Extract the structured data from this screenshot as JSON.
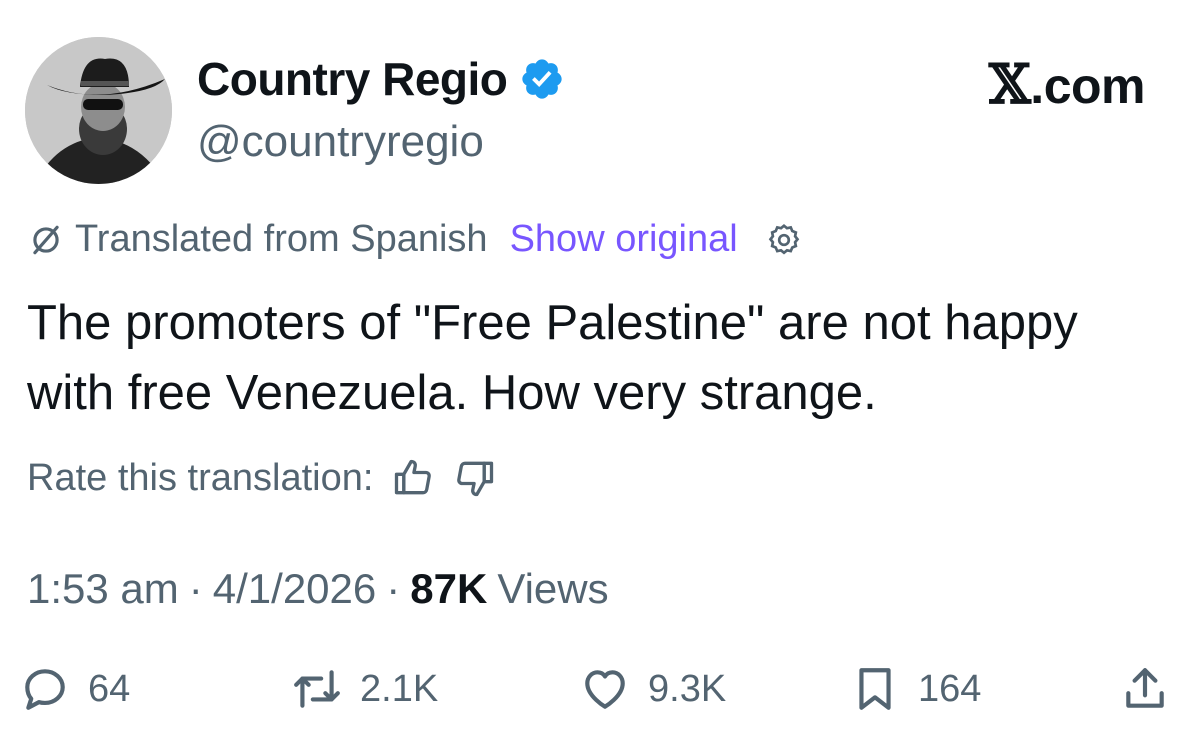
{
  "author": {
    "display_name": "Country Regio",
    "handle": "@countryregio",
    "verified": true,
    "verified_color": "#1d9bf0"
  },
  "site": {
    "x_glyph": "𝕏",
    "domain": ".com"
  },
  "translation": {
    "label": "Translated from Spanish",
    "show_original": "Show original",
    "link_color": "#7856ff",
    "rate_label": "Rate this translation:"
  },
  "tweet": {
    "text": "The promoters of \"Free Palestine\" are not happy with free Venezuela. How very strange."
  },
  "meta": {
    "time": "1:53 am",
    "separator1": "·",
    "date": "4/1/2026",
    "separator2": "·",
    "views_count": "87K",
    "views_label": "Views"
  },
  "actions": {
    "replies": "64",
    "reposts": "2.1K",
    "likes": "9.3K",
    "bookmarks": "164"
  },
  "icons": {
    "verified": "verified-badge-icon",
    "translate": "globe-slash-icon",
    "settings": "gear-icon",
    "thumbs_up": "thumbs-up-icon",
    "thumbs_down": "thumbs-down-icon",
    "reply": "reply-icon",
    "repost": "repost-icon",
    "like": "heart-icon",
    "bookmark": "bookmark-icon",
    "share": "share-icon"
  }
}
